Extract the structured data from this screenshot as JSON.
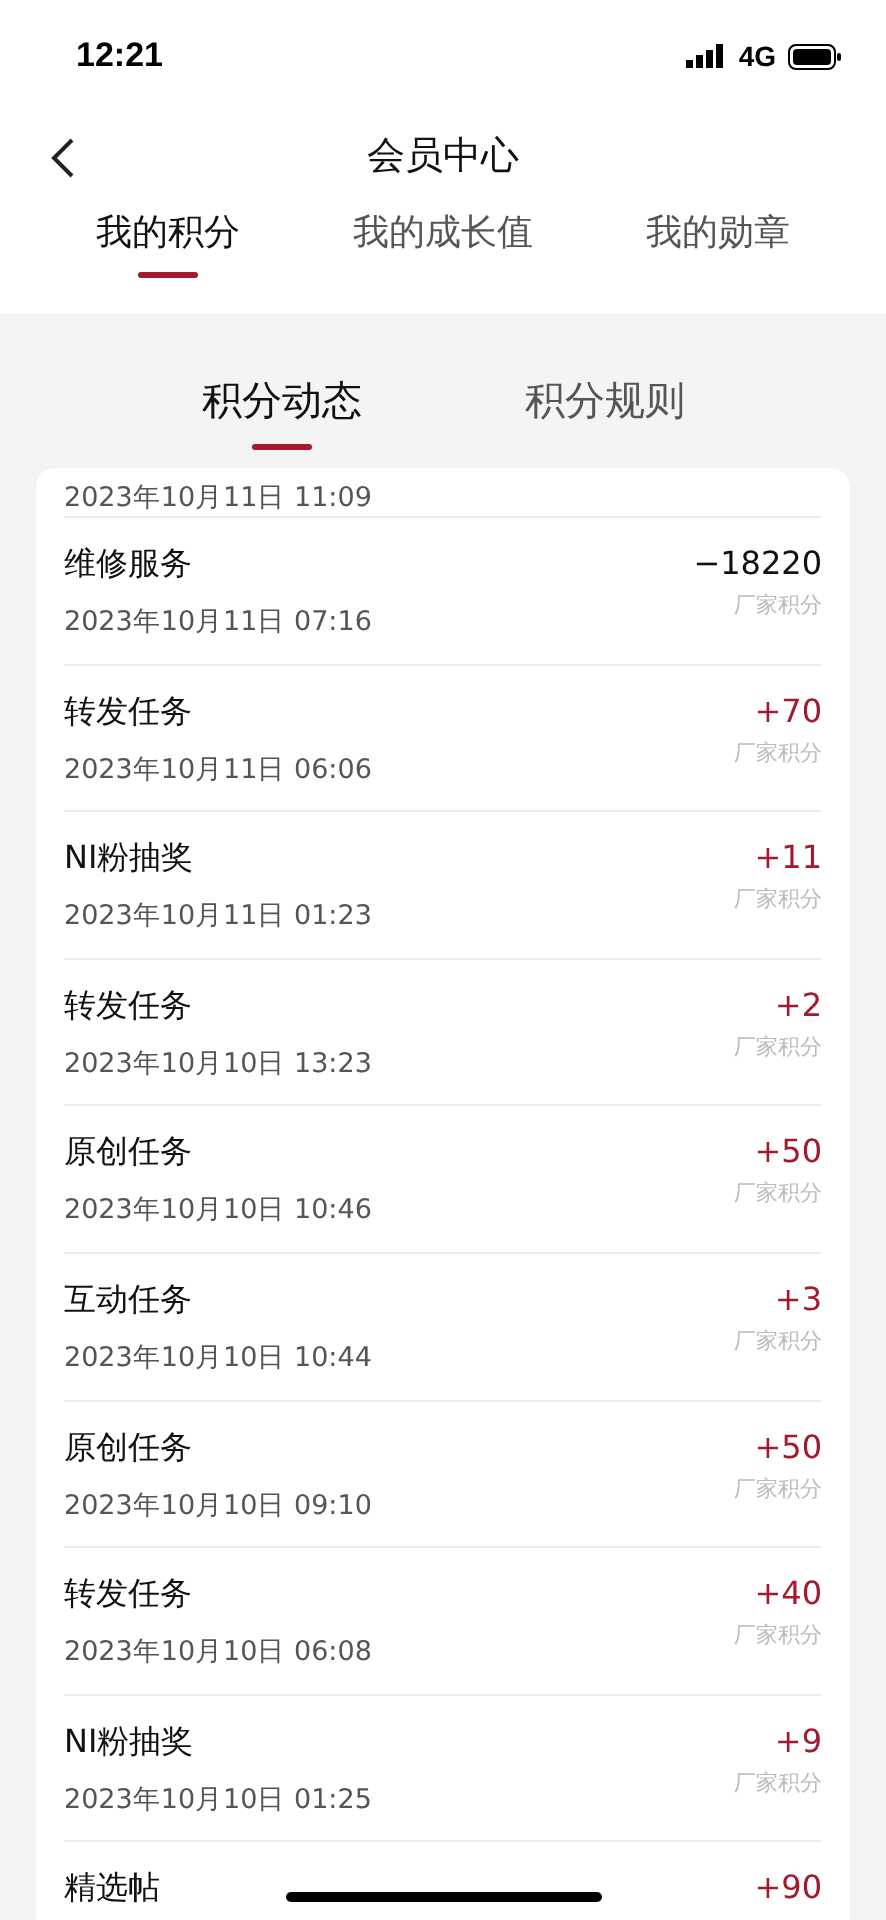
{
  "status_bar": {
    "time": "12:21",
    "network": "4G"
  },
  "header": {
    "title": "会员中心"
  },
  "tabs": [
    {
      "label": "我的积分",
      "selected": true
    },
    {
      "label": "我的成长值",
      "selected": false
    },
    {
      "label": "我的勋章",
      "selected": false
    }
  ],
  "sub_tabs": [
    {
      "label": "积分动态",
      "selected": true
    },
    {
      "label": "积分规则",
      "selected": false
    }
  ],
  "records_partial": {
    "date": "2023年10月11日 11:09"
  },
  "records": [
    {
      "title": "维修服务",
      "date": "2023年10月11日 07:16",
      "amount": "−18220",
      "kind": "debit",
      "source": "厂家积分"
    },
    {
      "title": "转发任务",
      "date": "2023年10月11日 06:06",
      "amount": "+70",
      "kind": "credit",
      "source": "厂家积分"
    },
    {
      "title": "NI粉抽奖",
      "date": "2023年10月11日 01:23",
      "amount": "+11",
      "kind": "credit",
      "source": "厂家积分"
    },
    {
      "title": "转发任务",
      "date": "2023年10月10日 13:23",
      "amount": "+2",
      "kind": "credit",
      "source": "厂家积分"
    },
    {
      "title": "原创任务",
      "date": "2023年10月10日 10:46",
      "amount": "+50",
      "kind": "credit",
      "source": "厂家积分"
    },
    {
      "title": "互动任务",
      "date": "2023年10月10日 10:44",
      "amount": "+3",
      "kind": "credit",
      "source": "厂家积分"
    },
    {
      "title": "原创任务",
      "date": "2023年10月10日 09:10",
      "amount": "+50",
      "kind": "credit",
      "source": "厂家积分"
    },
    {
      "title": "转发任务",
      "date": "2023年10月10日 06:08",
      "amount": "+40",
      "kind": "credit",
      "source": "厂家积分"
    },
    {
      "title": "NI粉抽奖",
      "date": "2023年10月10日 01:25",
      "amount": "+9",
      "kind": "credit",
      "source": "厂家积分"
    },
    {
      "title": "精选帖",
      "amount": "+90",
      "kind": "credit"
    }
  ]
}
